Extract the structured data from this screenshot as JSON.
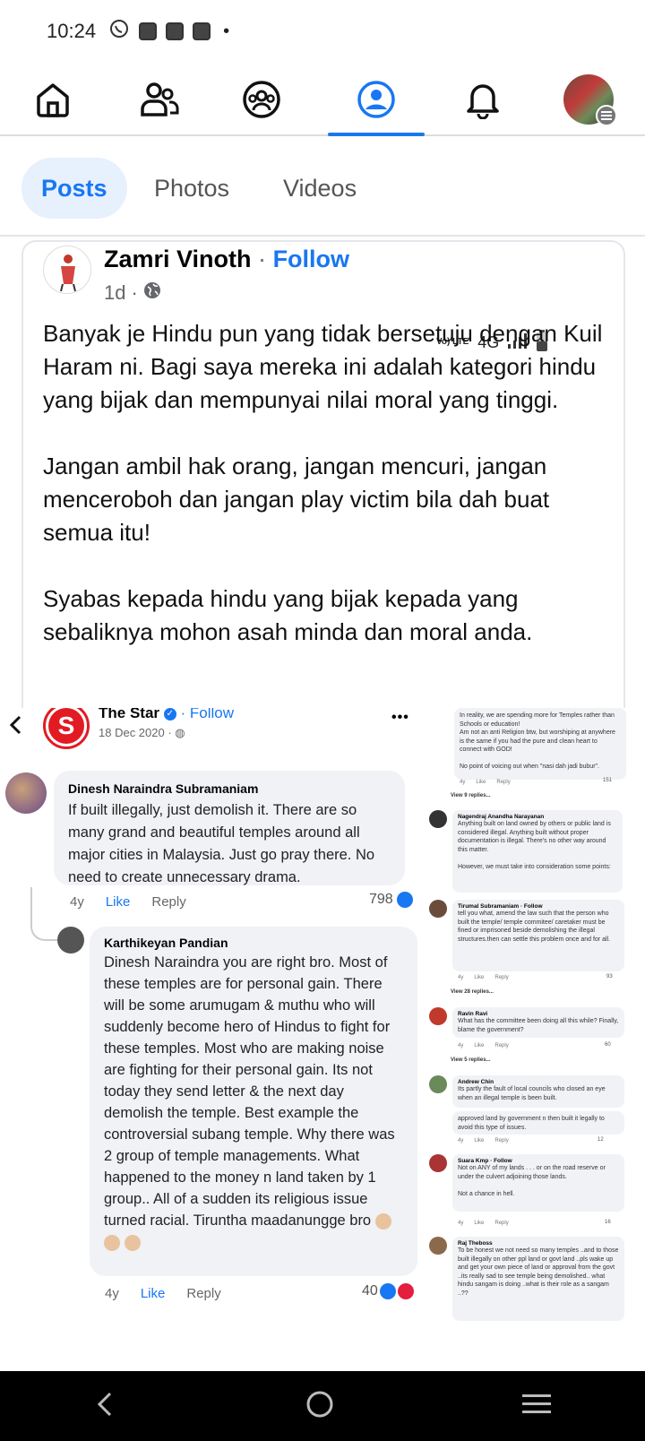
{
  "status_bar": {
    "time": "10:24",
    "network": "4G",
    "volte": "Vo) LTE"
  },
  "nav": {
    "items": [
      "home-icon",
      "friends-icon",
      "groups-icon",
      "profile-icon",
      "notifications-icon",
      "menu-avatar"
    ],
    "active": "profile-icon"
  },
  "tabs": [
    {
      "label": "Posts",
      "active": true
    },
    {
      "label": "Photos",
      "active": false
    },
    {
      "label": "Videos",
      "active": false
    }
  ],
  "post": {
    "author": "Zamri Vinoth",
    "separator": "·",
    "follow": "Follow",
    "time": "1d",
    "paragraphs": [
      "Banyak je Hindu pun yang tidak bersetuju dengan Kuil Haram ni. Bagi saya mereka ini adalah kategori hindu yang bijak dan mempunyai nilai moral yang tinggi.",
      "Jangan ambil hak orang, jangan mencuri, jangan menceroboh dan jangan play victim bila dah buat semua itu!",
      "Syabas kepada hindu yang bijak kepada yang sebaliknya mohon asah minda dan moral anda."
    ]
  },
  "embedded": {
    "page_name": "The Star",
    "follow": "· Follow",
    "date": "18 Dec 2020 ·",
    "more": "•••",
    "logo_letter": "S",
    "comment1": {
      "name": "Dinesh Naraindra Subramaniam",
      "text": "If built illegally, just demolish it. There are so many grand and beautiful temples around all major cities in Malaysia. Just go pray there. No need to create unnecessary drama.",
      "age": "4y",
      "like": "Like",
      "reply": "Reply",
      "count": "798"
    },
    "comment2": {
      "name": "Karthikeyan Pandian",
      "text": "Dinesh Naraindra you are right bro. Most of these temples are for personal gain. There will be some arumugam & muthu who will suddenly become hero of Hindus to fight for these temples. Most who are making noise are fighting for their personal gain. Its not today they send letter & the next day demolish the temple. Best example the controversial subang temple. Why there was 2  group of temple managements. What happened to the money n land taken by 1 group.. All of a sudden its religious issue turned racial. Tiruntha maadanungge bro",
      "age": "4y",
      "like": "Like",
      "reply": "Reply",
      "count": "40"
    },
    "right_comments": [
      {
        "name": "",
        "text": "In reality, we are spending more for Temples rather than Schools or education!\nAm not an anti Religion btw, but worshiping at anywhere is the same if you had the pure and clean heart to connect with GOD!\n\nNo point of voicing out when \"nasi dah jadi bubur\".",
        "age": "4y",
        "like": "Like",
        "reply": "Reply",
        "count": "151",
        "view": "View 9 replies..."
      },
      {
        "name": "Nagendraj Anandha Narayanan",
        "text": "Anything built on land owned by others or public land is considered illegal. Anything built without proper documentation is illegal. There's no other way around this matter.\n\nHowever, we must take into consideration some points:",
        "age": "",
        "like": "",
        "reply": "",
        "count": "",
        "view": ""
      },
      {
        "name": "Tirumal Subramaniam · Follow",
        "text": "tell you what, amend the law such  that the person who built the temple/ temple commitee/ caretaker must be fined or imprisoned beside demolishing the illegal structures.then can settle this problem once and for all.",
        "age": "4y",
        "like": "Like",
        "reply": "Reply",
        "count": "93",
        "view": "View 28 replies..."
      },
      {
        "name": "Ravin Ravi",
        "text": "What has the committee been doing all this while? Finally, blame the government?",
        "age": "4y",
        "like": "Like",
        "reply": "Reply",
        "count": "60",
        "view": "View 5 replies..."
      },
      {
        "name": "Andrew Chin",
        "text": "Its partly the fault of local councils who closed an eye when an illegal temple is been built.",
        "age": "",
        "like": "",
        "reply": "",
        "count": "",
        "view": ""
      },
      {
        "name": "",
        "text": "approved land by government n then built it legally to avoid this type of issues.",
        "age": "4y",
        "like": "Like",
        "reply": "Reply",
        "count": "12",
        "view": ""
      },
      {
        "name": "Suara Kmp · Follow",
        "text": "Not on ANY of my lands . . . or on the road reserve or under the culvert adjoining those lands.\n\nNot a chance in hell.",
        "age": "4y",
        "like": "Like",
        "reply": "Reply",
        "count": "16",
        "view": ""
      },
      {
        "name": "Raj Theboss",
        "text": "To be honest we not need so many temples ..and to those built illegally on other ppl land or govt land ..pls wake up and get your own piece of land or approval from the govt ..its really sad to see temple being demolished.. what hindu sangam is doing ..what is their role as a sangam ..??",
        "age": "",
        "like": "",
        "reply": "",
        "count": "",
        "view": ""
      }
    ]
  },
  "colors": {
    "accent": "#1877f2",
    "bubble": "#f0f2f5",
    "star_red": "#e21b23"
  }
}
